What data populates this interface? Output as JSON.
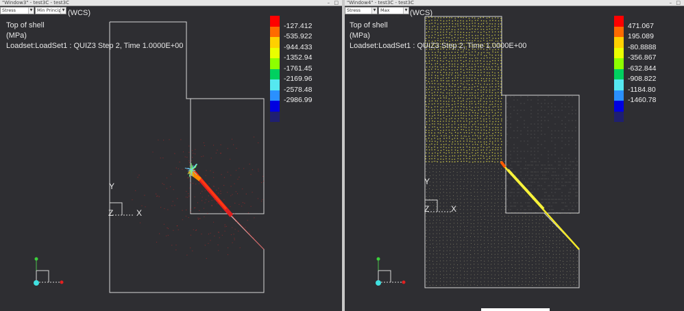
{
  "windows": [
    {
      "id": "left",
      "title": "\"Window3\" - test3C - test3C",
      "controls": "– □",
      "dropdowns": [
        "Stress",
        "Min Principal"
      ],
      "wcs": "(WCS)",
      "info": [
        "Top of shell",
        "(MPa)",
        "Loadset:LoadSet1 :  QUIZ3 Step 2, Time  1.0000E+00"
      ],
      "legend": {
        "colors": [
          "#ff0000",
          "#ff6a00",
          "#ffd000",
          "#eaff00",
          "#8dff00",
          "#00d060",
          "#55e8f0",
          "#2a90ff",
          "#0000e0",
          "#1f1f70"
        ],
        "labels": [
          "-127.412",
          "-535.922",
          "-944.433",
          "-1352.94",
          "-1761.45",
          "-2169.96",
          "-2578.48",
          "-2986.99"
        ]
      },
      "axes": {
        "y": "Y",
        "z": "Z",
        "x": "X"
      }
    },
    {
      "id": "right",
      "title": "\"Window4\" - test3C - test3C",
      "controls": "– □",
      "dropdowns": [
        "Stress",
        "Max Principal"
      ],
      "wcs": "(WCS)",
      "info": [
        "Top of shell",
        "(MPa)",
        "Loadset:LoadSet1 :  QUIZ3 Step 2, Time  1.0000E+00"
      ],
      "legend": {
        "colors": [
          "#ff0000",
          "#ff6a00",
          "#ffd000",
          "#eaff00",
          "#8dff00",
          "#00d060",
          "#55e8f0",
          "#2a90ff",
          "#0000e0",
          "#1f1f70"
        ],
        "labels": [
          "471.067",
          "195.089",
          "-80.8888",
          "-356.867",
          "-632.844",
          "-908.822",
          "-1184.80",
          "-1460.78"
        ]
      },
      "axes": {
        "y": "Y",
        "z": "Z",
        "x": "X"
      }
    }
  ]
}
